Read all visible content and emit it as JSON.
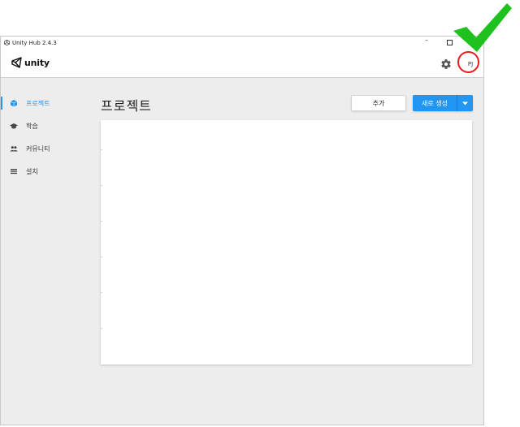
{
  "window": {
    "title": "Unity Hub 2.4.3",
    "min_glyph": "–"
  },
  "header": {
    "logo_text": "unity",
    "user_initials": "PJ"
  },
  "sidebar": {
    "items": [
      {
        "label": "프로젝트",
        "icon": "cube-icon",
        "active": true
      },
      {
        "label": "학습",
        "icon": "graduation-cap-icon",
        "active": false
      },
      {
        "label": "커뮤니티",
        "icon": "people-icon",
        "active": false
      },
      {
        "label": "설치",
        "icon": "list-icon",
        "active": false
      }
    ]
  },
  "main": {
    "title": "프로젝트",
    "add_label": "추가",
    "new_label": "새로 생성"
  },
  "annotations": {
    "check_color": "#1fc11f",
    "circle_color": "#e41c1c"
  },
  "colors": {
    "accent": "#2196f3"
  }
}
